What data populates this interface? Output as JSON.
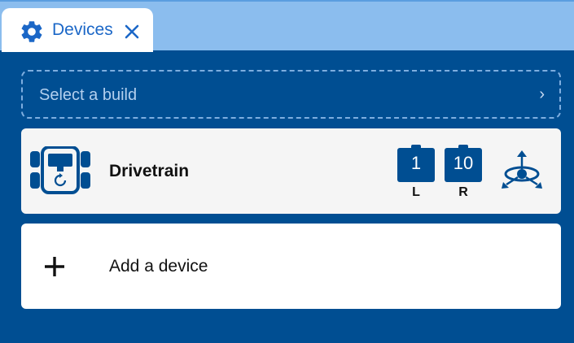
{
  "tab": {
    "label": "Devices",
    "icon": "gear-icon",
    "close_icon": "close-icon"
  },
  "build_select": {
    "label": "Select a build",
    "chevron": "›"
  },
  "devices": [
    {
      "name": "Drivetrain",
      "icon": "drivetrain-icon",
      "ports": [
        {
          "number": "1",
          "side": "L"
        },
        {
          "number": "10",
          "side": "R"
        }
      ],
      "sensor_icon": "gyro-icon"
    }
  ],
  "add_device": {
    "label": "Add a device",
    "icon": "plus-icon"
  },
  "colors": {
    "background": "#004e92",
    "tab_strip": "#8bbdee",
    "accent": "#1b67c7",
    "card": "#f5f5f5"
  }
}
